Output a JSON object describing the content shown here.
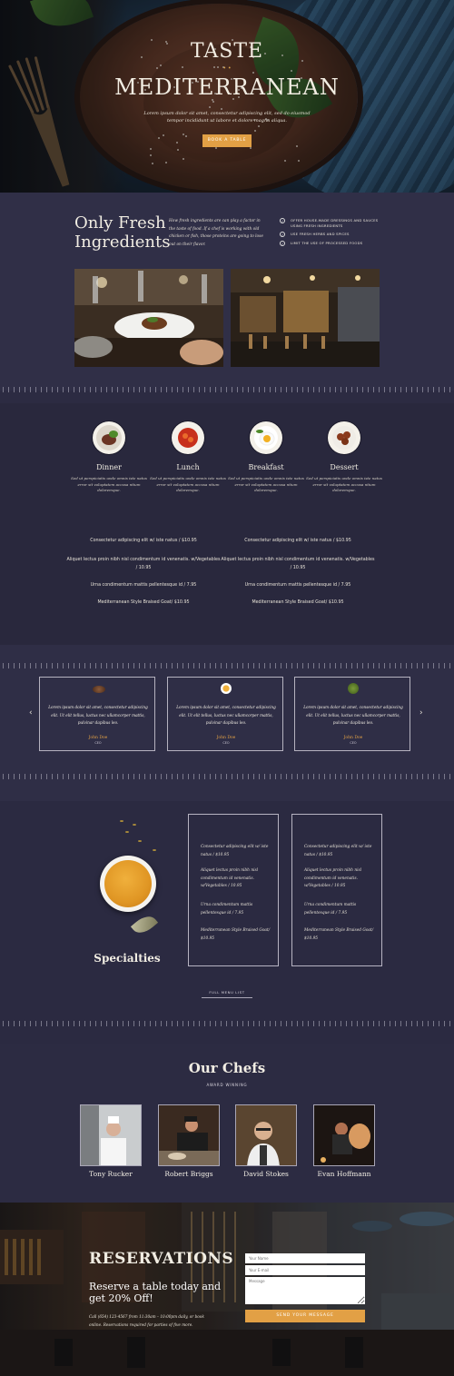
{
  "hero": {
    "title_line1": "TASTE",
    "title_line2": "MEDITERRANEAN",
    "separator": "• •",
    "subtitle": "Lorem ipsum dolor sit amet, consectetur adipiscing elit, sed do eiusmod tempor incididunt ut labore et dolore magna aliqua.",
    "cta": "BOOK A TABLE"
  },
  "ingredients": {
    "heading_line1": "Only Fresh",
    "heading_line2": "Ingredients",
    "paragraph": "How fresh ingredients are can play a factor in the taste of food. If a chef is working with old chicken or fish, those proteins are going to lose out on their flavor.",
    "checklist": [
      "OFFER HOUSE-MADE DRESSINGS AND SAUCES USING FRESH INGREDIENTS",
      "USE FRESH HERBS AND SPICES",
      "LIMIT THE USE OF PROCESSED FOODS"
    ]
  },
  "menu": {
    "categories": [
      {
        "name": "Dinner",
        "desc": "Sed ut perspiciatis unde omnis iste natus error sit voluptatem accusa ntium doloremque."
      },
      {
        "name": "Lunch",
        "desc": "Sed ut perspiciatis unde omnis iste natus error sit voluptatem accusa ntium doloremque."
      },
      {
        "name": "Breakfast",
        "desc": "Sed ut perspiciatis unde omnis iste natus error sit voluptatem accusa ntium doloremque."
      },
      {
        "name": "Dessert",
        "desc": "Sed ut perspiciatis unde omnis iste natus error sit voluptatem accusa ntium doloremque."
      }
    ],
    "items_left": [
      "Consectetur adipiscing elit w/ iste natus / $10.95",
      "Aliquet lectus proin nibh nisl condimentum id venenatis. w/Vegetables / 10.95",
      "Urna condimentum mattis pellentesque id / 7.95",
      "Mediterranean Style Braised Goat/ $10.95"
    ],
    "items_right": [
      "Consectetur adipiscing elit w/ iste natus / $10.95",
      "Aliquet lectus proin nibh nisl condimentum id venenatis. w/Vegetables / 10.95",
      "Urna condimentum mattis pellentesque id / 7.95",
      "Mediterranean Style Braised Goat/ $10.95"
    ]
  },
  "testimonials": {
    "prev": "‹",
    "next": "›",
    "cards": [
      {
        "quote": "Lorem ipsum dolor sit amet, consectetur adipiscing elit. Ut elit tellus, luctus nec ullamcorper mattis, pulvinar dapibus leo.",
        "author": "John Doe",
        "role": "CEO"
      },
      {
        "quote": "Lorem ipsum dolor sit amet, consectetur adipiscing elit. Ut elit tellus, luctus nec ullamcorper mattis, pulvinar dapibus leo.",
        "author": "John Doe",
        "role": "CEO"
      },
      {
        "quote": "Lorem ipsum dolor sit amet, consectetur adipiscing elit. Ut elit tellus, luctus nec ullamcorper mattis, pulvinar dapibus leo.",
        "author": "John Doe",
        "role": "CEO"
      }
    ]
  },
  "specialties": {
    "title": "Specialties",
    "col1": [
      "Consectetur adipiscing elit w/ iste natus / $10.95",
      "Aliquet lectus proin nibh nisl condimentum id venenatis. w/Vegetables / 10.95",
      "Urna condimentum mattis pellentesque id / 7.95",
      "Mediterranean Style Braised Goat/ $10.95"
    ],
    "col2": [
      "Consectetur adipiscing elit w/ iste natus / $10.95",
      "Aliquet lectus proin nibh nisl condimentum id venenatis. w/Vegetables / 10.95",
      "Urna condimentum mattis pellentesque id / 7.95",
      "Mediterranean Style Braised Goat/ $10.95"
    ],
    "full_menu": "FULL MENU LIST"
  },
  "chefs": {
    "title": "Our Chefs",
    "subtitle": "AWARD WINNING",
    "people": [
      {
        "name": "Tony Rucker"
      },
      {
        "name": "Robert Briggs"
      },
      {
        "name": "David Stokes"
      },
      {
        "name": "Evan Hoffmann"
      }
    ]
  },
  "reservations": {
    "title": "RESERVATIONS",
    "offer": "Reserve a table today and get 20% Off!",
    "note": "Call (654) 123-4567 from 11:30am – 10:00pm daily, or book online. Reservations required for parties of five more.",
    "name_placeholder": "Your Name",
    "email_placeholder": "Your E-mail",
    "message_placeholder": "Message",
    "submit": "SEND YOUR MESSAGE"
  },
  "colors": {
    "accent": "#e2a045",
    "background": "#2c2b42"
  }
}
